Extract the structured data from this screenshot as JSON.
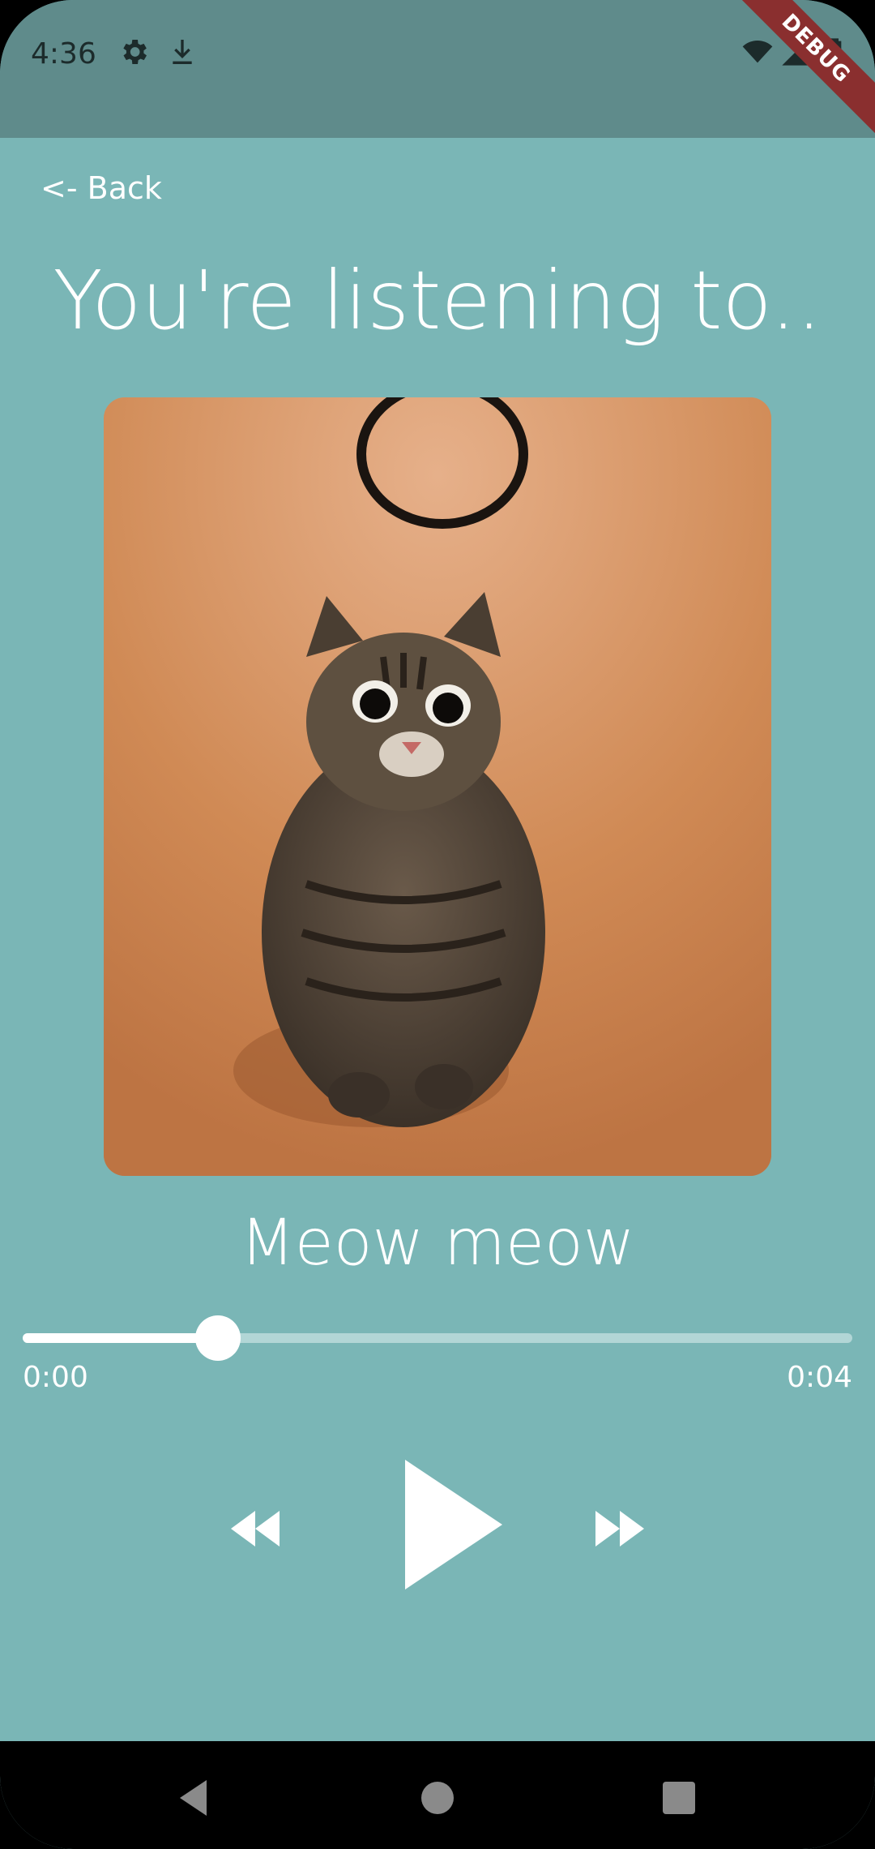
{
  "status_bar": {
    "time": "4:36",
    "icons_left": [
      "settings-icon",
      "download-icon"
    ],
    "icons_right": [
      "wifi-icon",
      "signal-icon",
      "battery-icon"
    ],
    "debug_label": "DEBUG"
  },
  "player": {
    "back_label": "<- Back",
    "title": "You're listening to..",
    "song_name": "Meow meow",
    "elapsed": "0:00",
    "duration": "0:04",
    "progress_fraction": 0.235,
    "controls": [
      "rewind-icon",
      "play-icon",
      "fast-forward-icon"
    ]
  },
  "nav_bar": {
    "buttons": [
      "back-triangle-icon",
      "home-circle-icon",
      "recents-square-icon"
    ]
  },
  "colors": {
    "background": "#7ab6b6",
    "status_bar": "#5f8b8b",
    "accent": "#ffffff"
  }
}
